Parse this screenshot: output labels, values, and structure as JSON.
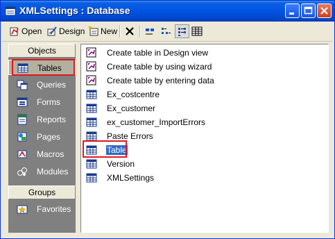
{
  "window": {
    "title": "XMLSettings : Database"
  },
  "toolbar": {
    "open": "Open",
    "design": "Design",
    "new": "New"
  },
  "left_pane": {
    "objects_header": "Objects",
    "items": [
      {
        "label": "Tables",
        "icon": "table-icon"
      },
      {
        "label": "Queries",
        "icon": "query-icon"
      },
      {
        "label": "Forms",
        "icon": "form-icon"
      },
      {
        "label": "Reports",
        "icon": "report-icon"
      },
      {
        "label": "Pages",
        "icon": "page-icon"
      },
      {
        "label": "Macros",
        "icon": "macro-icon"
      },
      {
        "label": "Modules",
        "icon": "module-icon"
      }
    ],
    "selected_item": "Tables",
    "groups_header": "Groups",
    "group_items": [
      {
        "label": "Favorites",
        "icon": "favorites-icon"
      }
    ]
  },
  "objects": [
    {
      "label": "Create table in Design view",
      "type": "shortcut"
    },
    {
      "label": "Create table by using wizard",
      "type": "shortcut"
    },
    {
      "label": "Create table by entering data",
      "type": "shortcut"
    },
    {
      "label": "Ex_costcentre",
      "type": "table"
    },
    {
      "label": "Ex_customer",
      "type": "table"
    },
    {
      "label": "ex_customer_ImportErrors",
      "type": "table"
    },
    {
      "label": "Paste Errors",
      "type": "table"
    },
    {
      "label": "Table",
      "type": "table"
    },
    {
      "label": "Version",
      "type": "table"
    },
    {
      "label": "XMLSettings",
      "type": "table"
    }
  ],
  "selected_object": "Table",
  "colors": {
    "title_bar": "#0054e3",
    "selection": "#316ac5",
    "highlight_box": "#e0171e",
    "pane_gray": "#808080"
  }
}
